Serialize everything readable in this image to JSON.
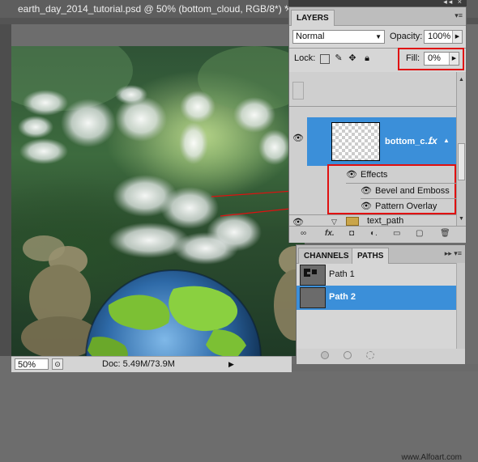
{
  "document": {
    "title": "earth_day_2014_tutorial.psd @ 50% (bottom_cloud, RGB/8*) *",
    "close_glyph": "×"
  },
  "status_bar": {
    "zoom": "50%",
    "doc_info": "Doc: 5.49M/73.9M"
  },
  "layers_panel": {
    "tab_label": "LAYERS",
    "blend_mode": "Normal",
    "opacity_label": "Opacity:",
    "opacity_value": "100%",
    "lock_label": "Lock:",
    "fill_label": "Fill:",
    "fill_value": "0%",
    "selected_layer": {
      "name": "bottom_c...",
      "fx_badge": "fx"
    },
    "effects_header": "Effects",
    "effects": [
      "Bevel and Emboss",
      "Pattern Overlay"
    ],
    "group_layer": "text_path",
    "icons": [
      "link-icon",
      "fx-icon",
      "mask-icon",
      "adjustment-icon",
      "folder-icon",
      "new-layer-icon",
      "trash-icon"
    ]
  },
  "paths_panel": {
    "tabs": [
      "CHANNELS",
      "PATHS"
    ],
    "active_tab": "PATHS",
    "paths": [
      {
        "name": "Path 1",
        "selected": false
      },
      {
        "name": "Path 2",
        "selected": true
      }
    ],
    "watermark": "www.Alfoart.com"
  },
  "colors": {
    "selection": "#3b8fd9",
    "highlight_box": "#e01010",
    "panel_bg": "#d6d6d6"
  }
}
